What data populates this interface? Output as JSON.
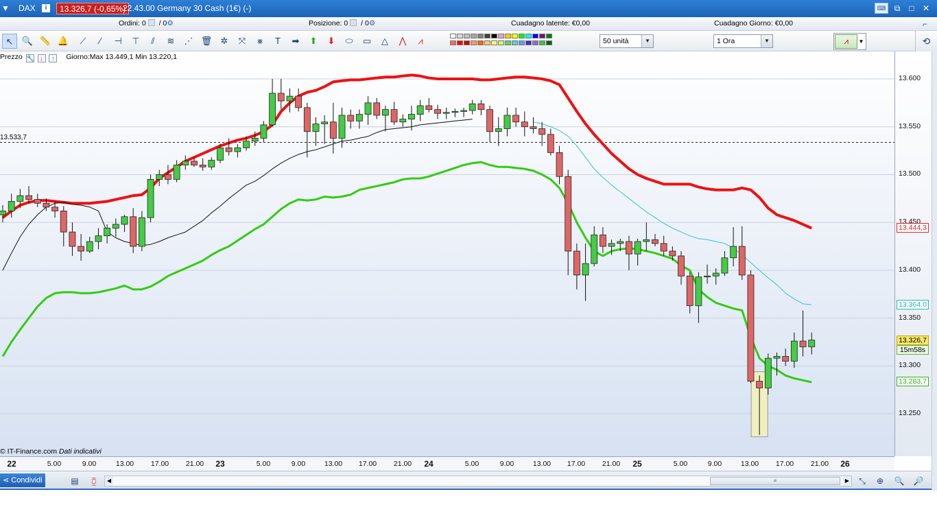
{
  "titlebar": {
    "symbol": "DAX",
    "info_glyph": "i",
    "change": "13.326,7 (-0,65%)",
    "name": "22.43.00 Germany 30 Cash (1€) (-)",
    "controls": [
      "keyboard",
      "restore",
      "maximize",
      "close"
    ],
    "control_glyphs": [
      "⌨",
      "⧉",
      "□",
      "✕"
    ]
  },
  "infobar": {
    "ordini_label": "Ordini:",
    "ordini_value": "0",
    "ordini_sep": "/ 0",
    "posizione_label": "Posizione:",
    "posizione_value": "0",
    "posizione_sep": "/ 0",
    "latente_label": "Cuadagno latente:",
    "latente_value": "€0,00",
    "giorno_label": "Cuadagno Giorno:",
    "giorno_value": "€0,00"
  },
  "toolbar": {
    "units": "50 unità",
    "timeframe": "1 Ora",
    "tools": [
      "pointer",
      "zoom",
      "ruler",
      "alert-bell",
      "trend-line",
      "line",
      "horizontal-line",
      "vertical-line",
      "channel",
      "regression",
      "fibonacci",
      "wave",
      "trash",
      "settings",
      "arrows",
      "cross-lines",
      "text",
      "arrow-right",
      "arrow-up",
      "arrow-down",
      "ellipse",
      "rectangle",
      "triangle",
      "pattern",
      "zigzag"
    ],
    "colors_top": [
      "#ffffff",
      "#d9d9d9",
      "#bfbfbf",
      "#a6a6a6",
      "#808080",
      "#404040",
      "#000000",
      "#ff99cc",
      "#ffcc00",
      "#ffff00",
      "#00ff00",
      "#00ffff",
      "#0000ff",
      "#800080",
      "#008000"
    ],
    "colors_bottom": [
      "#ff6666",
      "#ff0000",
      "#cc0000",
      "#ff9966",
      "#ff6600",
      "#ffcc66",
      "#ffff66",
      "#ccff66",
      "#66cc66",
      "#66cccc",
      "#6699ff",
      "#3333cc",
      "#9966cc",
      "#33cc33",
      "#006600"
    ]
  },
  "chart": {
    "prezzo_label": "Prezzo",
    "day_range": "Giorno:Max 13.449,1 Min 13.220,1",
    "copyright": "© IT-Finance.com",
    "copyright_note": "Dati indicativi",
    "dashed_level_label": "13.533,7",
    "y_ticks": [
      "13.600",
      "13.550",
      "13.500",
      "13.450",
      "13.400",
      "13.350",
      "13.300",
      "13.250"
    ],
    "price_tags": {
      "upper": "13.444,3",
      "middle": "13.364,0",
      "last": "13.326,7",
      "timer": "15m58s",
      "lower": "13.283,7"
    },
    "x_ticks": [
      {
        "label": "22",
        "day": true
      },
      {
        "label": "5.00",
        "day": false
      },
      {
        "label": "9.00",
        "day": false
      },
      {
        "label": "13.00",
        "day": false
      },
      {
        "label": "17.00",
        "day": false
      },
      {
        "label": "21.00",
        "day": false
      },
      {
        "label": "23",
        "day": true
      },
      {
        "label": "5.00",
        "day": false
      },
      {
        "label": "9.00",
        "day": false
      },
      {
        "label": "13.00",
        "day": false
      },
      {
        "label": "17.00",
        "day": false
      },
      {
        "label": "21.00",
        "day": false
      },
      {
        "label": "24",
        "day": true
      },
      {
        "label": "5.00",
        "day": false
      },
      {
        "label": "9.00",
        "day": false
      },
      {
        "label": "13.00",
        "day": false
      },
      {
        "label": "17.00",
        "day": false
      },
      {
        "label": "21.00",
        "day": false
      },
      {
        "label": "25",
        "day": true
      },
      {
        "label": "5.00",
        "day": false
      },
      {
        "label": "9.00",
        "day": false
      },
      {
        "label": "13.00",
        "day": false
      },
      {
        "label": "17.00",
        "day": false
      },
      {
        "label": "21.00",
        "day": false
      },
      {
        "label": "26",
        "day": true
      }
    ],
    "colors": {
      "up": "#44cc44",
      "down": "#e06666",
      "upper_band": "#ee1111",
      "lower_band": "#33cc11",
      "ma": "#111111",
      "ma2": "#33c6cc",
      "highlight": "#f0efc0"
    },
    "y_range": [
      13200,
      13630
    ],
    "candles": [
      [
        13458,
        13468,
        13450,
        13462
      ],
      [
        13462,
        13480,
        13455,
        13472
      ],
      [
        13472,
        13485,
        13465,
        13478
      ],
      [
        13478,
        13488,
        13470,
        13474
      ],
      [
        13474,
        13480,
        13466,
        13470
      ],
      [
        13470,
        13475,
        13462,
        13466
      ],
      [
        13466,
        13472,
        13455,
        13462
      ],
      [
        13462,
        13467,
        13425,
        13440
      ],
      [
        13440,
        13450,
        13415,
        13425
      ],
      [
        13425,
        13438,
        13410,
        13420
      ],
      [
        13420,
        13435,
        13418,
        13430
      ],
      [
        13430,
        13444,
        13422,
        13436
      ],
      [
        13436,
        13448,
        13428,
        13444
      ],
      [
        13444,
        13454,
        13435,
        13448
      ],
      [
        13448,
        13458,
        13440,
        13456
      ],
      [
        13456,
        13465,
        13418,
        13425
      ],
      [
        13425,
        13462,
        13420,
        13455
      ],
      [
        13455,
        13500,
        13450,
        13495
      ],
      [
        13495,
        13505,
        13488,
        13500
      ],
      [
        13500,
        13510,
        13490,
        13495
      ],
      [
        13495,
        13515,
        13492,
        13510
      ],
      [
        13510,
        13520,
        13505,
        13514
      ],
      [
        13514,
        13518,
        13508,
        13510
      ],
      [
        13510,
        13517,
        13504,
        13508
      ],
      [
        13508,
        13518,
        13505,
        13515
      ],
      [
        13515,
        13532,
        13512,
        13528
      ],
      [
        13528,
        13538,
        13520,
        13524
      ],
      [
        13524,
        13532,
        13518,
        13528
      ],
      [
        13528,
        13540,
        13525,
        13535
      ],
      [
        13535,
        13545,
        13530,
        13538
      ],
      [
        13538,
        13556,
        13534,
        13552
      ],
      [
        13552,
        13600,
        13550,
        13585
      ],
      [
        13585,
        13600,
        13568,
        13577
      ],
      [
        13577,
        13590,
        13565,
        13582
      ],
      [
        13582,
        13590,
        13566,
        13570
      ],
      [
        13570,
        13575,
        13518,
        13545
      ],
      [
        13545,
        13560,
        13530,
        13553
      ],
      [
        13553,
        13562,
        13532,
        13555
      ],
      [
        13555,
        13575,
        13522,
        13538
      ],
      [
        13538,
        13570,
        13528,
        13562
      ],
      [
        13562,
        13568,
        13548,
        13556
      ],
      [
        13556,
        13568,
        13548,
        13563
      ],
      [
        13563,
        13582,
        13552,
        13575
      ],
      [
        13575,
        13580,
        13558,
        13562
      ],
      [
        13562,
        13572,
        13545,
        13568
      ],
      [
        13568,
        13576,
        13552,
        13555
      ],
      [
        13555,
        13563,
        13550,
        13558
      ],
      [
        13558,
        13572,
        13546,
        13563
      ],
      [
        13563,
        13578,
        13556,
        13572
      ],
      [
        13572,
        13580,
        13565,
        13568
      ],
      [
        13568,
        13573,
        13558,
        13564
      ],
      [
        13564,
        13570,
        13558,
        13565
      ],
      [
        13565,
        13569,
        13560,
        13566
      ],
      [
        13566,
        13570,
        13560,
        13567
      ],
      [
        13567,
        13578,
        13563,
        13574
      ],
      [
        13574,
        13578,
        13562,
        13568
      ],
      [
        13568,
        13572,
        13534,
        13545
      ],
      [
        13545,
        13560,
        13530,
        13548
      ],
      [
        13548,
        13570,
        13540,
        13562
      ],
      [
        13562,
        13570,
        13550,
        13555
      ],
      [
        13555,
        13566,
        13540,
        13550
      ],
      [
        13550,
        13560,
        13543,
        13548
      ],
      [
        13548,
        13555,
        13530,
        13542
      ],
      [
        13542,
        13548,
        13520,
        13523
      ],
      [
        13523,
        13530,
        13490,
        13498
      ],
      [
        13498,
        13505,
        13395,
        13420
      ],
      [
        13420,
        13428,
        13380,
        13395
      ],
      [
        13395,
        13428,
        13368,
        13407
      ],
      [
        13407,
        13446,
        13404,
        13437
      ],
      [
        13437,
        13445,
        13418,
        13425
      ],
      [
        13425,
        13432,
        13416,
        13428
      ],
      [
        13428,
        13433,
        13420,
        13430
      ],
      [
        13430,
        13436,
        13400,
        13417
      ],
      [
        13417,
        13433,
        13405,
        13430
      ],
      [
        13430,
        13450,
        13420,
        13432
      ],
      [
        13432,
        13438,
        13425,
        13428
      ],
      [
        13428,
        13436,
        13415,
        13420
      ],
      [
        13420,
        13425,
        13410,
        13415
      ],
      [
        13415,
        13420,
        13385,
        13394
      ],
      [
        13394,
        13398,
        13355,
        13363
      ],
      [
        13363,
        13398,
        13345,
        13393
      ],
      [
        13393,
        13406,
        13386,
        13394
      ],
      [
        13394,
        13402,
        13385,
        13397
      ],
      [
        13397,
        13420,
        13394,
        13413
      ],
      [
        13413,
        13445,
        13404,
        13425
      ],
      [
        13425,
        13446,
        13390,
        13395
      ],
      [
        13395,
        13400,
        13282,
        13284
      ],
      [
        13284,
        13290,
        13228,
        13277
      ],
      [
        13277,
        13313,
        13270,
        13308
      ],
      [
        13308,
        13314,
        13290,
        13310
      ],
      [
        13310,
        13318,
        13300,
        13305
      ],
      [
        13305,
        13335,
        13298,
        13326
      ],
      [
        13326,
        13358,
        13310,
        13320
      ],
      [
        13320,
        13335,
        13312,
        13327
      ]
    ],
    "highlight_candle": 87,
    "ma_black": [
      13400,
      13418,
      13435,
      13448,
      13458,
      13466,
      13470,
      13471,
      13469,
      13468,
      13466,
      13462,
      13440,
      13434,
      13430,
      13428,
      13426,
      13427,
      13430,
      13434,
      13437,
      13440,
      13446,
      13452,
      13460,
      13467,
      13475,
      13482,
      13489,
      13493,
      13499,
      13506,
      13512,
      13517,
      13521,
      13524,
      13526,
      13529,
      13532,
      13535,
      13536,
      13538,
      13540,
      13544,
      13547,
      13548,
      13549,
      13550,
      13552,
      13553,
      13554,
      13555,
      13556,
      13557,
      13558
    ],
    "ma_black_start": 0,
    "ma_cyan": [
      13555,
      13553,
      13550,
      13546,
      13540,
      13530,
      13518,
      13506,
      13497,
      13489,
      13482,
      13475,
      13468,
      13461,
      13455,
      13449,
      13444,
      13440,
      13436,
      13433,
      13432,
      13430,
      13428,
      13423,
      13416,
      13408,
      13400,
      13392,
      13385,
      13376,
      13370,
      13365,
      13364
    ],
    "ma_cyan_start": 61,
    "upper_band": [
      13455,
      13462,
      13468,
      13471,
      13473,
      13473,
      13472,
      13471,
      13470,
      13470,
      13470,
      13471,
      13472,
      13474,
      13476,
      13478,
      13479,
      13486,
      13496,
      13502,
      13508,
      13514,
      13518,
      13522,
      13526,
      13530,
      13533,
      13536,
      13538,
      13541,
      13545,
      13552,
      13566,
      13575,
      13582,
      13586,
      13588,
      13592,
      13597,
      13598,
      13599,
      13599,
      13600,
      13601,
      13602,
      13602,
      13603,
      13604,
      13603,
      13601,
      13600,
      13600,
      13600,
      13600,
      13600,
      13599,
      13599,
      13600,
      13601,
      13602,
      13602,
      13601,
      13600,
      13598,
      13594,
      13580,
      13566,
      13553,
      13542,
      13532,
      13522,
      13514,
      13506,
      13500,
      13496,
      13493,
      13490,
      13490,
      13490,
      13490,
      13487,
      13485,
      13484,
      13484,
      13484,
      13486,
      13484,
      13476,
      13465,
      13458,
      13455,
      13452,
      13448,
      13444
    ],
    "lower_band": [
      13310,
      13325,
      13338,
      13350,
      13362,
      13371,
      13376,
      13377,
      13377,
      13376,
      13376,
      13377,
      13379,
      13381,
      13384,
      13380,
      13380,
      13383,
      13388,
      13394,
      13398,
      13402,
      13406,
      13410,
      13416,
      13421,
      13425,
      13431,
      13437,
      13443,
      13448,
      13456,
      13464,
      13470,
      13474,
      13473,
      13474,
      13477,
      13476,
      13477,
      13479,
      13484,
      13486,
      13488,
      13490,
      13492,
      13495,
      13496,
      13496,
      13498,
      13501,
      13504,
      13507,
      13510,
      13512,
      13513,
      13510,
      13508,
      13508,
      13507,
      13506,
      13504,
      13500,
      13495,
      13486,
      13470,
      13450,
      13434,
      13420,
      13415,
      13420,
      13422,
      13423,
      13422,
      13420,
      13418,
      13415,
      13412,
      13405,
      13400,
      13380,
      13372,
      13366,
      13363,
      13360,
      13358,
      13330,
      13308,
      13300,
      13296,
      13290,
      13287,
      13285,
      13283
    ]
  },
  "bottombar": {
    "share_label": "Condividi"
  }
}
